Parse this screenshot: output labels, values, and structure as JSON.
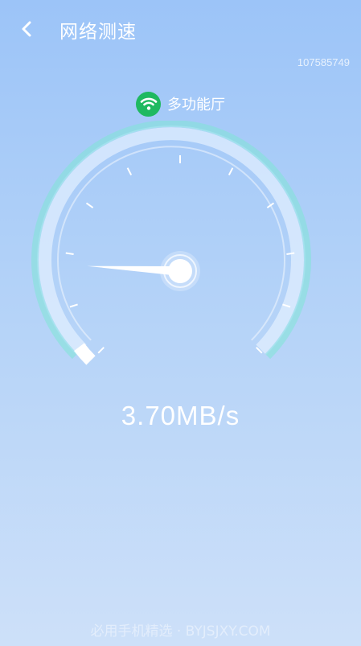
{
  "header": {
    "back_icon": "chevron-left-icon",
    "title": "网络测速"
  },
  "device_id": "107585749",
  "network": {
    "icon": "wifi-icon",
    "icon_color": "#1fb960",
    "name": "多功能厅"
  },
  "gauge": {
    "level_fraction": 0.03,
    "accent_color": "#7fe6d6",
    "active_color": "#ffffff"
  },
  "speed": {
    "value": "3.70MB/s"
  },
  "watermark": "必用手机精选 · BYJSJXY.COM"
}
